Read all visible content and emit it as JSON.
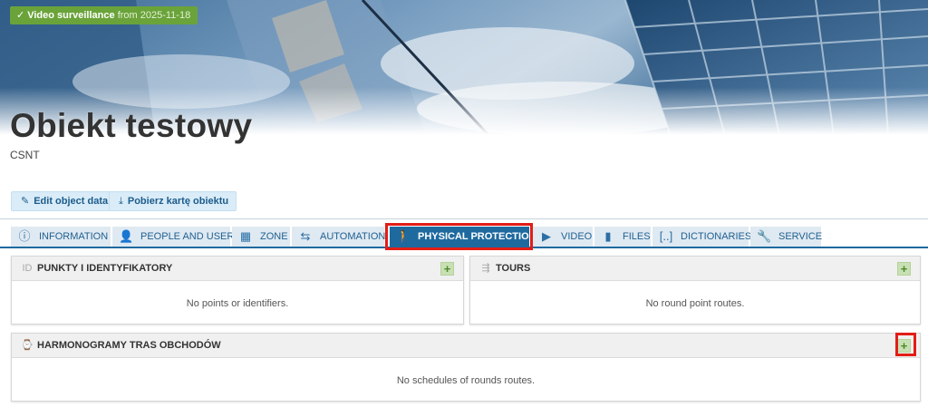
{
  "badge": {
    "check": "✓",
    "label": "Video surveillance",
    "from_text": "from 2025-11-18"
  },
  "object": {
    "title": "Obiekt testowy",
    "subtitle": "CSNT"
  },
  "actions": [
    {
      "icon": "✎",
      "label": "Edit object data"
    },
    {
      "icon": "⤓",
      "label": "Pobierz kartę obiektu"
    }
  ],
  "tabs": [
    {
      "icon": "ⓘ",
      "label": "INFORMATION"
    },
    {
      "icon": "👤",
      "label": "PEOPLE AND USERS"
    },
    {
      "icon": "▦",
      "label": "ZONE"
    },
    {
      "icon": "⇆",
      "label": "AUTOMATION"
    },
    {
      "icon": "🚶",
      "label": "PHYSICAL PROTECTION",
      "active": true
    },
    {
      "icon": "▶",
      "label": "VIDEO"
    },
    {
      "icon": "▮",
      "label": "FILES"
    },
    {
      "icon": "[..]",
      "label": "DICTIONARIES"
    },
    {
      "icon": "🔧",
      "label": "SERVICE"
    }
  ],
  "panels": {
    "points": {
      "icon": "ID",
      "title": "PUNKTY I IDENTYFIKATORY",
      "empty": "No points or identifiers.",
      "add": "+"
    },
    "tours": {
      "icon": "⇶",
      "title": "TOURS",
      "empty": "No round point routes.",
      "add": "+"
    },
    "schedules": {
      "icon": "⌚",
      "title": "HARMONOGRAMY TRAS OBCHODÓW",
      "empty": "No schedules of rounds routes.",
      "add": "+"
    }
  },
  "colors": {
    "accent": "#1e6a9f",
    "tab_bg": "#dfe9f2",
    "badge": "#6aa33a",
    "highlight": "#e21d16"
  }
}
